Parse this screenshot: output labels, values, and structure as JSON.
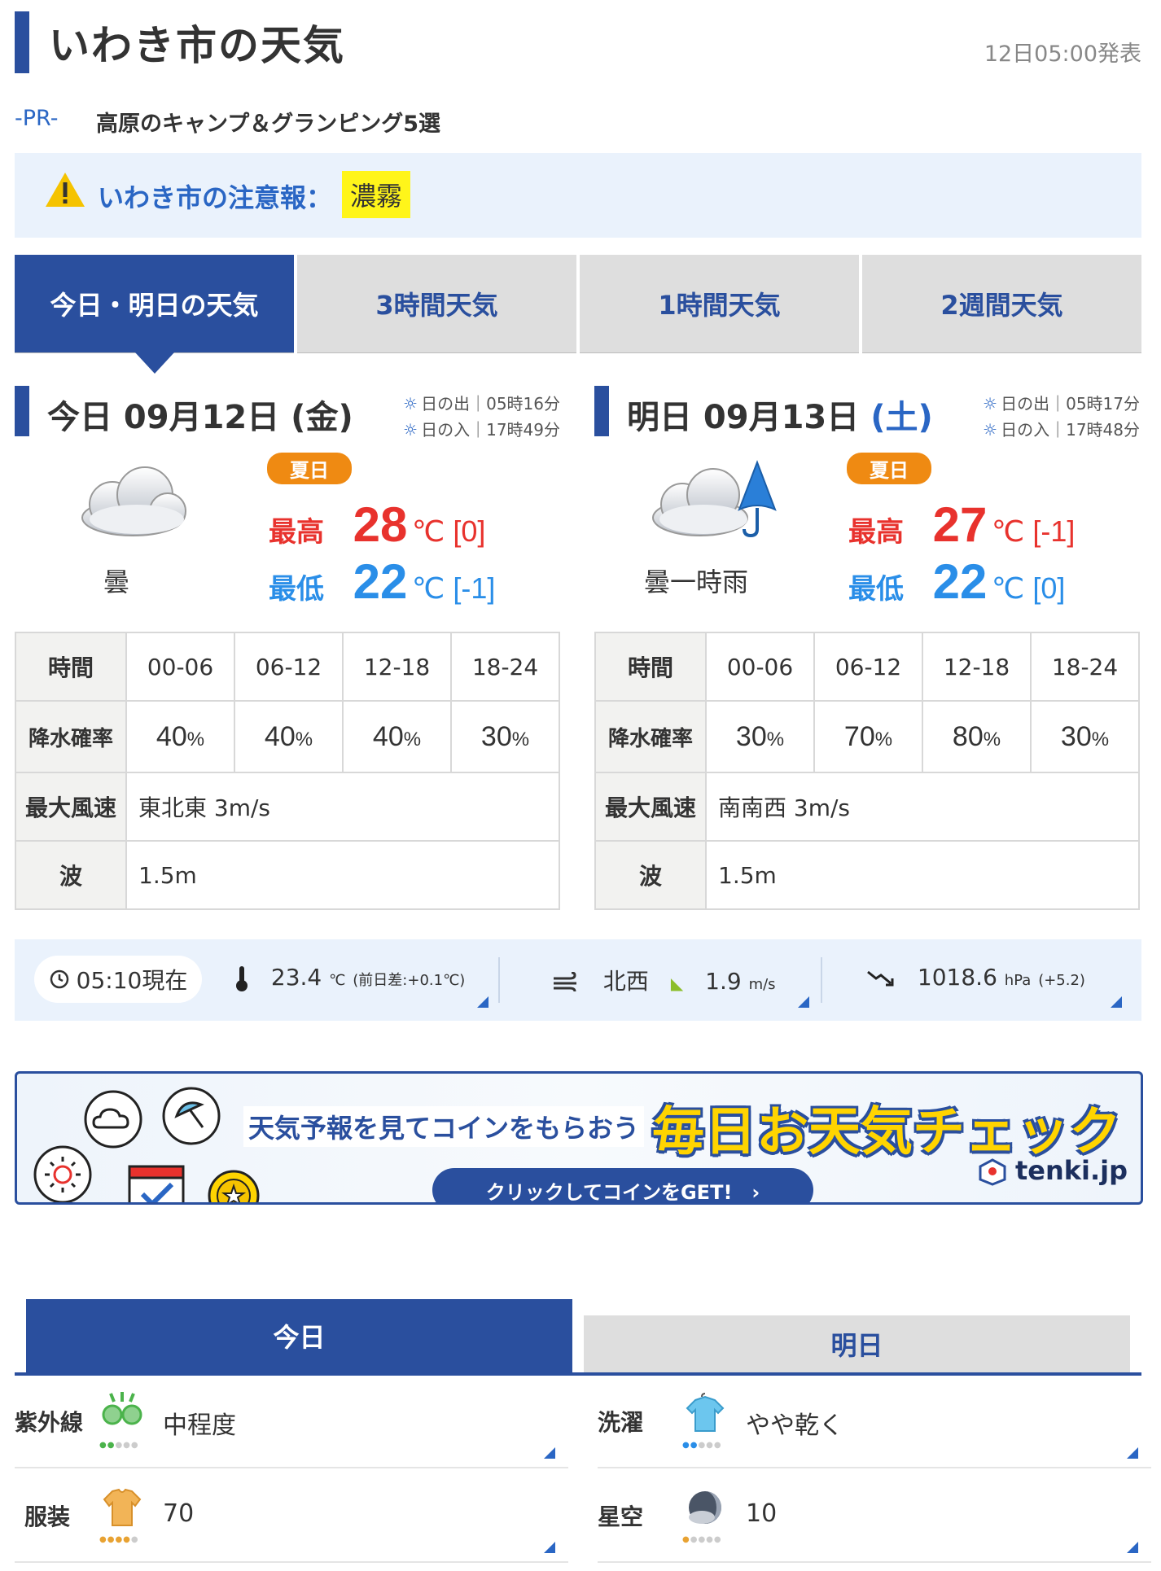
{
  "header": {
    "title": "いわき市の天気",
    "issued": "12日05:00発表"
  },
  "pr": {
    "tag": "-PR-",
    "text": "高原のキャンプ＆グランピング5選"
  },
  "warning": {
    "label": "いわき市の注意報：",
    "item": "濃霧"
  },
  "tabs": [
    "今日・明日の天気",
    "3時間天気",
    "1時間天気",
    "2週間天気"
  ],
  "today": {
    "title_prefix": "今日 09月12日 (",
    "weekday": "金",
    "title_suffix": ")",
    "sunrise": "日の出｜05時16分",
    "sunset": "日の入｜17時49分",
    "telop": "曇",
    "badge": "夏日",
    "high_label": "最高",
    "high": "28",
    "high_unit": "℃ [0]",
    "low_label": "最低",
    "low": "22",
    "low_unit": "℃ [-1]",
    "table": {
      "time_label": "時間",
      "times": [
        "00-06",
        "06-12",
        "12-18",
        "18-24"
      ],
      "pop_label": "降水確率",
      "pops": [
        "40",
        "40",
        "40",
        "30"
      ],
      "pop_unit": "%",
      "wind_label": "最大風速",
      "wind": "東北東 3m/s",
      "wave_label": "波",
      "wave": "1.5m"
    }
  },
  "tomorrow": {
    "title_prefix": "明日 09月13日 ",
    "weekday": "(土)",
    "sunrise": "日の出｜05時17分",
    "sunset": "日の入｜17時48分",
    "telop": "曇一時雨",
    "badge": "夏日",
    "high_label": "最高",
    "high": "27",
    "high_unit": "℃ [-1]",
    "low_label": "最低",
    "low": "22",
    "low_unit": "℃ [0]",
    "table": {
      "time_label": "時間",
      "times": [
        "00-06",
        "06-12",
        "12-18",
        "18-24"
      ],
      "pop_label": "降水確率",
      "pops": [
        "30",
        "70",
        "80",
        "30"
      ],
      "pop_unit": "%",
      "wind_label": "最大風速",
      "wind": "南南西 3m/s",
      "wave_label": "波",
      "wave": "1.5m"
    }
  },
  "obs": {
    "time": "05:10現在",
    "temp": "23.4",
    "temp_unit": "℃",
    "temp_diff": "(前日差:+0.1℃)",
    "wind_dir": "北西",
    "wind_speed": "1.9",
    "wind_unit": "m/s",
    "pressure": "1018.6",
    "pressure_unit": "hPa",
    "pressure_diff": "(+5.2)"
  },
  "banner": {
    "lead": "天気予報を見てコインをもらおう",
    "main": "毎日お天気チェック",
    "button": "クリックしてコインをGET!　›",
    "brand": "tenki.jp"
  },
  "index_tabs": {
    "today": "今日",
    "tomorrow": "明日"
  },
  "indexes": [
    {
      "label": "紫外線",
      "value": "中程度",
      "icon": "uv-glasses-icon"
    },
    {
      "label": "洗濯",
      "value": "やや乾く",
      "icon": "laundry-shirt-icon"
    },
    {
      "label": "服装",
      "value": "70",
      "icon": "clothing-tshirt-icon"
    },
    {
      "label": "星空",
      "value": "10",
      "icon": "starry-sky-moon-icon"
    }
  ],
  "colors": {
    "brand": "#2a4f9e",
    "high": "#e8322d",
    "low": "#2a8ee8",
    "badge": "#ef8a12",
    "warning_chip": "#fff51a"
  }
}
